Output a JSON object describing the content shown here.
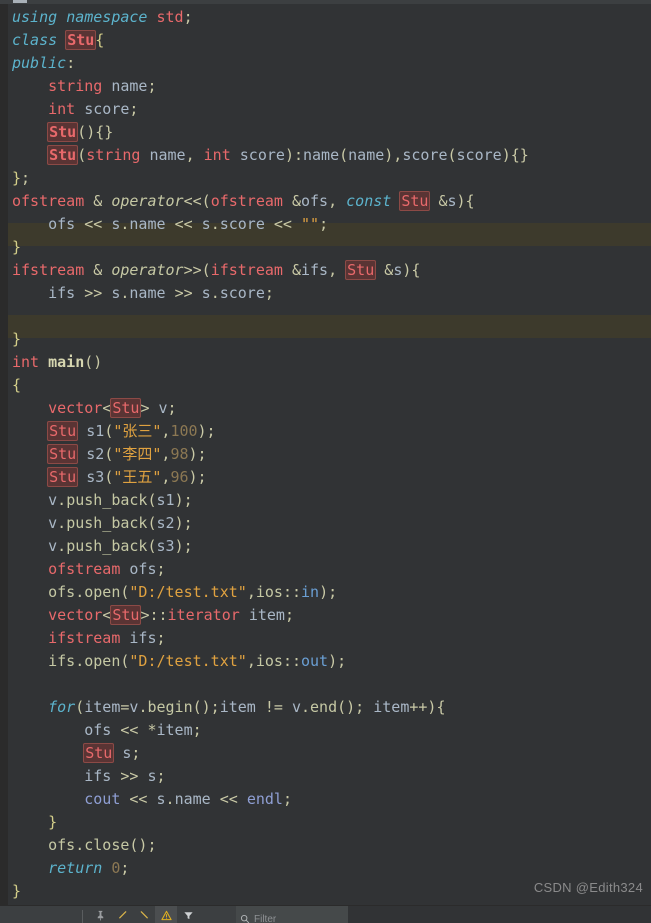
{
  "window": {
    "app": "code-editor",
    "theme": "darcula"
  },
  "colors": {
    "editor_background": "#313335",
    "gutter_background": "#2b2b2b",
    "line_highlight": "#3d3a2c",
    "default_text": "#a9b7c6",
    "keyword": "#5cb3cc",
    "type": "#e8696b",
    "string": "#e0a240",
    "number": "#8c7853",
    "function": "#c5c8a4",
    "brace": "#d4cf8a",
    "stream_object": "#8f9fd4",
    "marked_identifier_bg": "#5a3434",
    "marked_identifier_border": "#8c4a46",
    "toolbar_background": "#3c3f41"
  },
  "editor": {
    "language": "C++",
    "marked_identifier": "Stu",
    "highlighted_line_numbers": [
      10,
      14
    ],
    "line_count": 39,
    "lines": [
      "using namespace std;",
      "class Stu{",
      "public:",
      "    string name;",
      "    int score;",
      "    Stu(){}",
      "    Stu(string name, int score):name(name),score(score){}",
      "};",
      "ofstream & operator<<(ofstream &ofs, const Stu &s){",
      "    ofs << s.name << s.score << \"\";",
      "}",
      "ifstream & operator>>(ifstream &ifs, Stu &s){",
      "    ifs >> s.name >> s.score;",
      "",
      "}",
      "int main()",
      "{",
      "    vector<Stu> v;",
      "    Stu s1(\"张三\",100);",
      "    Stu s2(\"李四\",98);",
      "    Stu s3(\"王五\",96);",
      "    v.push_back(s1);",
      "    v.push_back(s2);",
      "    v.push_back(s3);",
      "    ofstream ofs;",
      "    ofs.open(\"D:/test.txt\",ios::in);",
      "    vector<Stu>::iterator item;",
      "    ifstream ifs;",
      "    ifs.open(\"D:/test.txt\",ios::out);",
      "",
      "    for(item=v.begin();item != v.end(); item++){",
      "        ofs << *item;",
      "        Stu s;",
      "        ifs >> s;",
      "        cout << s.name << endl;",
      "    }",
      "    ofs.close();",
      "    return 0;",
      "}"
    ]
  },
  "watermark": {
    "text": "CSDN @Edith324"
  },
  "bottom_toolbar": {
    "icons": [
      "separator",
      "pin-icon",
      "expand-all-icon",
      "collapse-all-icon",
      "warning-triangle-icon",
      "filter-funnel-icon"
    ],
    "filter": {
      "icon": "search-icon",
      "placeholder": "Filter"
    }
  }
}
